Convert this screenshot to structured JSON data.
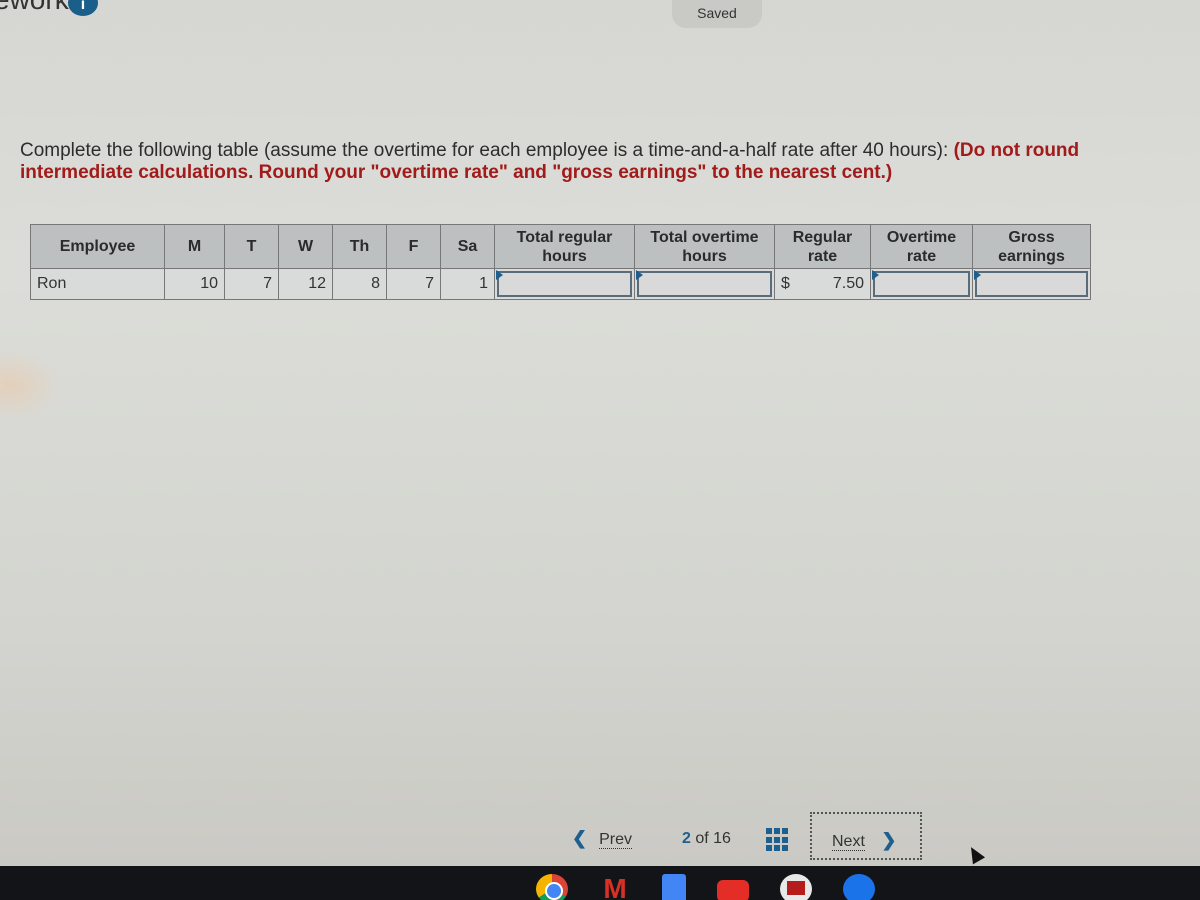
{
  "header": {
    "title_fragment": "ework",
    "info_badge": "i",
    "saved_status": "Saved"
  },
  "instructions": {
    "text": "Complete the following table (assume the overtime for each employee is a time-and-a-half rate after 40 hours): ",
    "note": "(Do not round intermediate calculations. Round your \"overtime rate\" and \"gross earnings\" to the nearest cent.)"
  },
  "table": {
    "headers": {
      "employee": "Employee",
      "m": "M",
      "t": "T",
      "w": "W",
      "th": "Th",
      "f": "F",
      "sa": "Sa",
      "total_regular_hours": "Total regular hours",
      "total_overtime_hours": "Total overtime hours",
      "regular_rate": "Regular rate",
      "overtime_rate": "Overtime rate",
      "gross_earnings": "Gross earnings"
    },
    "rows": [
      {
        "employee": "Ron",
        "m": "10",
        "t": "7",
        "w": "12",
        "th": "8",
        "f": "7",
        "sa": "1",
        "total_regular_hours": "",
        "total_overtime_hours": "",
        "regular_rate_currency": "$",
        "regular_rate": "7.50",
        "overtime_rate": "",
        "gross_earnings": ""
      }
    ]
  },
  "navigation": {
    "prev_label": "Prev",
    "current_page": "2",
    "of_label": "of",
    "total_pages": "16",
    "next_label": "Next",
    "prev_icon": "chevron-left-icon",
    "next_icon": "chevron-right-icon",
    "grid_icon": "question-grid-icon"
  },
  "taskbar": {
    "apps": [
      "chrome",
      "gmail",
      "docs",
      "youtube",
      "lock-app",
      "files"
    ]
  }
}
